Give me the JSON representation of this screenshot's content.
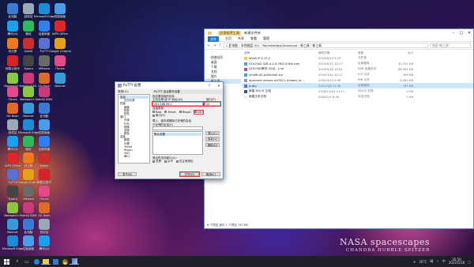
{
  "desktop": {
    "icons": [
      {
        "label": "此电脑",
        "color": "#3a7bd5"
      },
      {
        "label": "回收站",
        "color": "#9aa9b8"
      },
      {
        "label": "Microsoft Edge",
        "color": "#1f8ad6"
      },
      {
        "label": "控制面板",
        "color": "#4c9be8"
      },
      {
        "label": "腾讯QQ",
        "color": "#1aa0f0"
      },
      {
        "label": "微信",
        "color": "#2dba5a"
      },
      {
        "label": "百度网盘",
        "color": "#2f7ff0"
      },
      {
        "label": "WPS Office",
        "color": "#e0262a"
      },
      {
        "label": "向日葵",
        "color": "#f07a1b"
      },
      {
        "label": "Xshell",
        "color": "#c9302c"
      },
      {
        "label": "PuTTY",
        "color": "#5a6fd0"
      },
      {
        "label": "Google Chrome",
        "color": "#e8a21a"
      },
      {
        "label": "网易云音乐",
        "color": "#d6232b"
      },
      {
        "label": "Typora",
        "color": "#444444"
      },
      {
        "label": "VMware",
        "color": "#6a6a6a"
      },
      {
        "label": "iTunes",
        "color": "#e24a8a"
      },
      {
        "label": "Notepad++",
        "color": "#8dc63f"
      },
      {
        "label": "IntelliJ IDEA",
        "color": "#c83a7a"
      },
      {
        "label": "Git Bash",
        "color": "#e06a2a"
      },
      {
        "label": "Navicat",
        "color": "#3a9ad9"
      }
    ],
    "wallpaper_line1": "NASA spacescapes",
    "wallpaper_line2": "CHANDRA HUBBLE SPITZER"
  },
  "explorer": {
    "title": "新建文件夹",
    "tool_tab": "应用程序工具",
    "ribbon": [
      "文件",
      "主页",
      "共享",
      "查看",
      "管理"
    ],
    "path": "« 此电脑 › 本地磁盘 (D:) › BaiduNetdiskDownload › 新工具 › 新工具",
    "search_placeholder": "搜索\"新工具\"",
    "sidebar": [
      "快速访问",
      "桌面",
      "下载",
      "文档",
      "图片",
      "新工具",
      "此电脑",
      "网络"
    ],
    "columns": {
      "name": "名称",
      "date": "修改日期",
      "type": "类型",
      "size": "大小"
    },
    "files": [
      {
        "name": "WinSCP-5.13.2",
        "date": "2019/6/10 9:23",
        "type": "文件夹",
        "size": "",
        "color": "#f2c94c",
        "selected": false
      },
      {
        "name": "GOLOUD-328-4.2.5.76374-Win.exe",
        "date": "2019/5/22 10:17",
        "type": "应用程序",
        "size": "10,701 KB",
        "color": "#5b8def",
        "selected": false
      },
      {
        "name": "GOLOUD教学-528(...).rar",
        "date": "2019/5/16 15:52",
        "type": "RAR 压缩文件",
        "size": "86,591 KB",
        "color": "#a050c0",
        "selected": false
      },
      {
        "name": "ninefit-d2.pdf-break.ico",
        "date": "2019/3/14 10:17",
        "type": "ICO 文件",
        "size": "199 KB",
        "color": "#2fa8e0",
        "selected": false
      },
      {
        "name": "openvert-remips-mt7621-d-team_re...",
        "date": "2020/3/15 0:46",
        "type": "BIN 文件",
        "size": "6,592 KB",
        "color": "#999999",
        "selected": false
      },
      {
        "name": "putty",
        "date": "2021/3/8 13:46",
        "type": "应用程序",
        "size": "747 KB",
        "color": "#5a6fd0",
        "selected": true
      },
      {
        "name": "新建 DOCX 文档",
        "date": "2018/11/24 13:17",
        "type": "DOCX 文档",
        "size": "0 KB",
        "color": "#2b579a",
        "selected": false
      },
      {
        "name": "新建文本文档",
        "date": "2020/1/5 8:26",
        "type": "文本文档",
        "size": "0 KB",
        "color": "#eeeeee",
        "selected": false
      }
    ],
    "status": "8 个项目    选中 1 个项目  747 KB"
  },
  "putty": {
    "title": "PuTTY 配置",
    "help": "?",
    "close": "✕",
    "category_label": "类别(G):",
    "tree": [
      "会话",
      "日志记录",
      "终端",
      "键盘",
      "响铃",
      "特性",
      "窗口",
      "外观",
      "行为",
      "转换",
      "选择",
      "颜色",
      "连接",
      "数据",
      "代理",
      "Telnet",
      "Rlogin",
      "SSH",
      "串口"
    ],
    "header": "PuTTY 会话基本设置",
    "target_label": "指定要连接的目标",
    "host_label": "主机名称(或 IP 地址)(N)",
    "port_label": "端口(P)",
    "host_value": "192.168.99.1",
    "port_value": "22",
    "conn_type_label": "连接类型:",
    "conn_types": [
      "Raw",
      "Telnet",
      "Rlogin",
      "SSH"
    ],
    "serial_label": "串口(S)",
    "session_section": "载入、保存或删除已存储的会话",
    "saved_sessions_label": "已存储的会话(E)",
    "sessions": [
      "默认设置"
    ],
    "load_button": "载入(L)",
    "save_button": "保存(V)",
    "delete_button": "删除(D)",
    "close_exit_label": "退出时关闭窗口(X):",
    "close_options": [
      "总是",
      "从不",
      "仅正常退出"
    ],
    "about_button": "关于(A)",
    "open_button": "打开(O)",
    "cancel_button": "取消(C)"
  },
  "taskbar": {
    "search_placeholder": "在这里输入你要搜索的内容",
    "weather": "晴",
    "temperature": "26°C",
    "time": "20:50",
    "date": "2022/5/18",
    "input_method": "中"
  }
}
